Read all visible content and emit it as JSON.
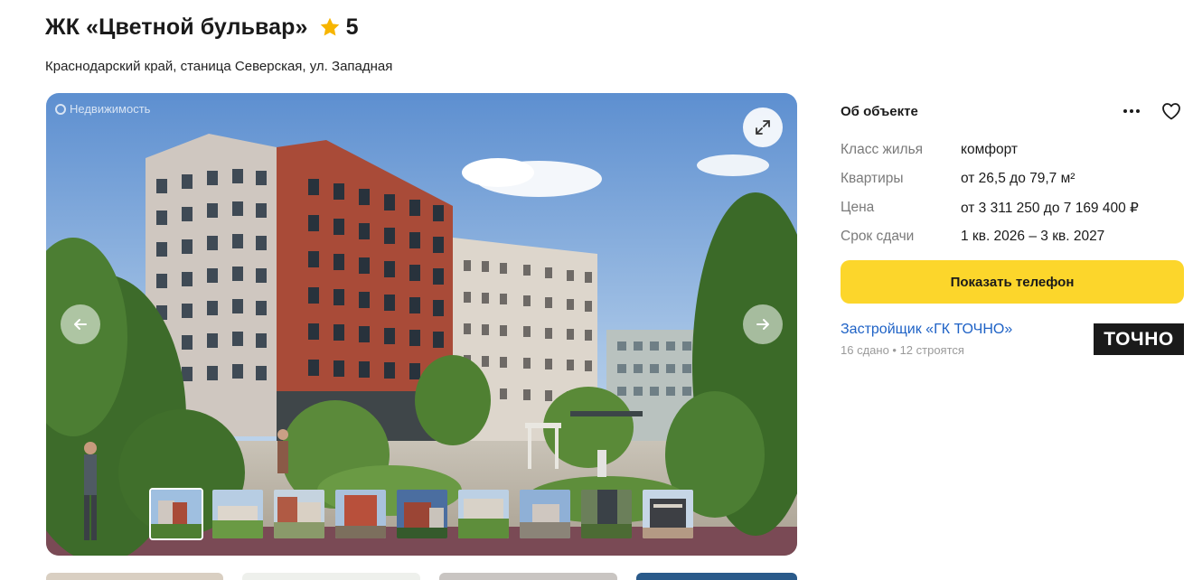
{
  "header": {
    "title": "ЖК «Цветной бульвар»",
    "rating": "5"
  },
  "address": "Краснодарский край, станица Северская, ул. Западная",
  "gallery": {
    "watermark": "Недвижимость",
    "thumbnail_count": 9,
    "active_index": 0
  },
  "info": {
    "title": "Об объекте",
    "properties": [
      {
        "label": "Класс жилья",
        "value": "комфорт"
      },
      {
        "label": "Квартиры",
        "value": "от 26,5 до 79,7 м²"
      },
      {
        "label": "Цена",
        "value": "от 3 311 250 до 7 169 400 ₽"
      },
      {
        "label": "Срок сдачи",
        "value": "1 кв. 2026 – 3 кв. 2027"
      }
    ],
    "phone_button": "Показать телефон",
    "developer": {
      "link": "Застройщик «ГК ТОЧНО»",
      "stats": "16 сдано • 12 строятся",
      "logo_text": "ТОЧНО"
    }
  },
  "colors": {
    "accent_yellow": "#fcd62b",
    "link_blue": "#1e62c6",
    "star": "#f7b500"
  }
}
